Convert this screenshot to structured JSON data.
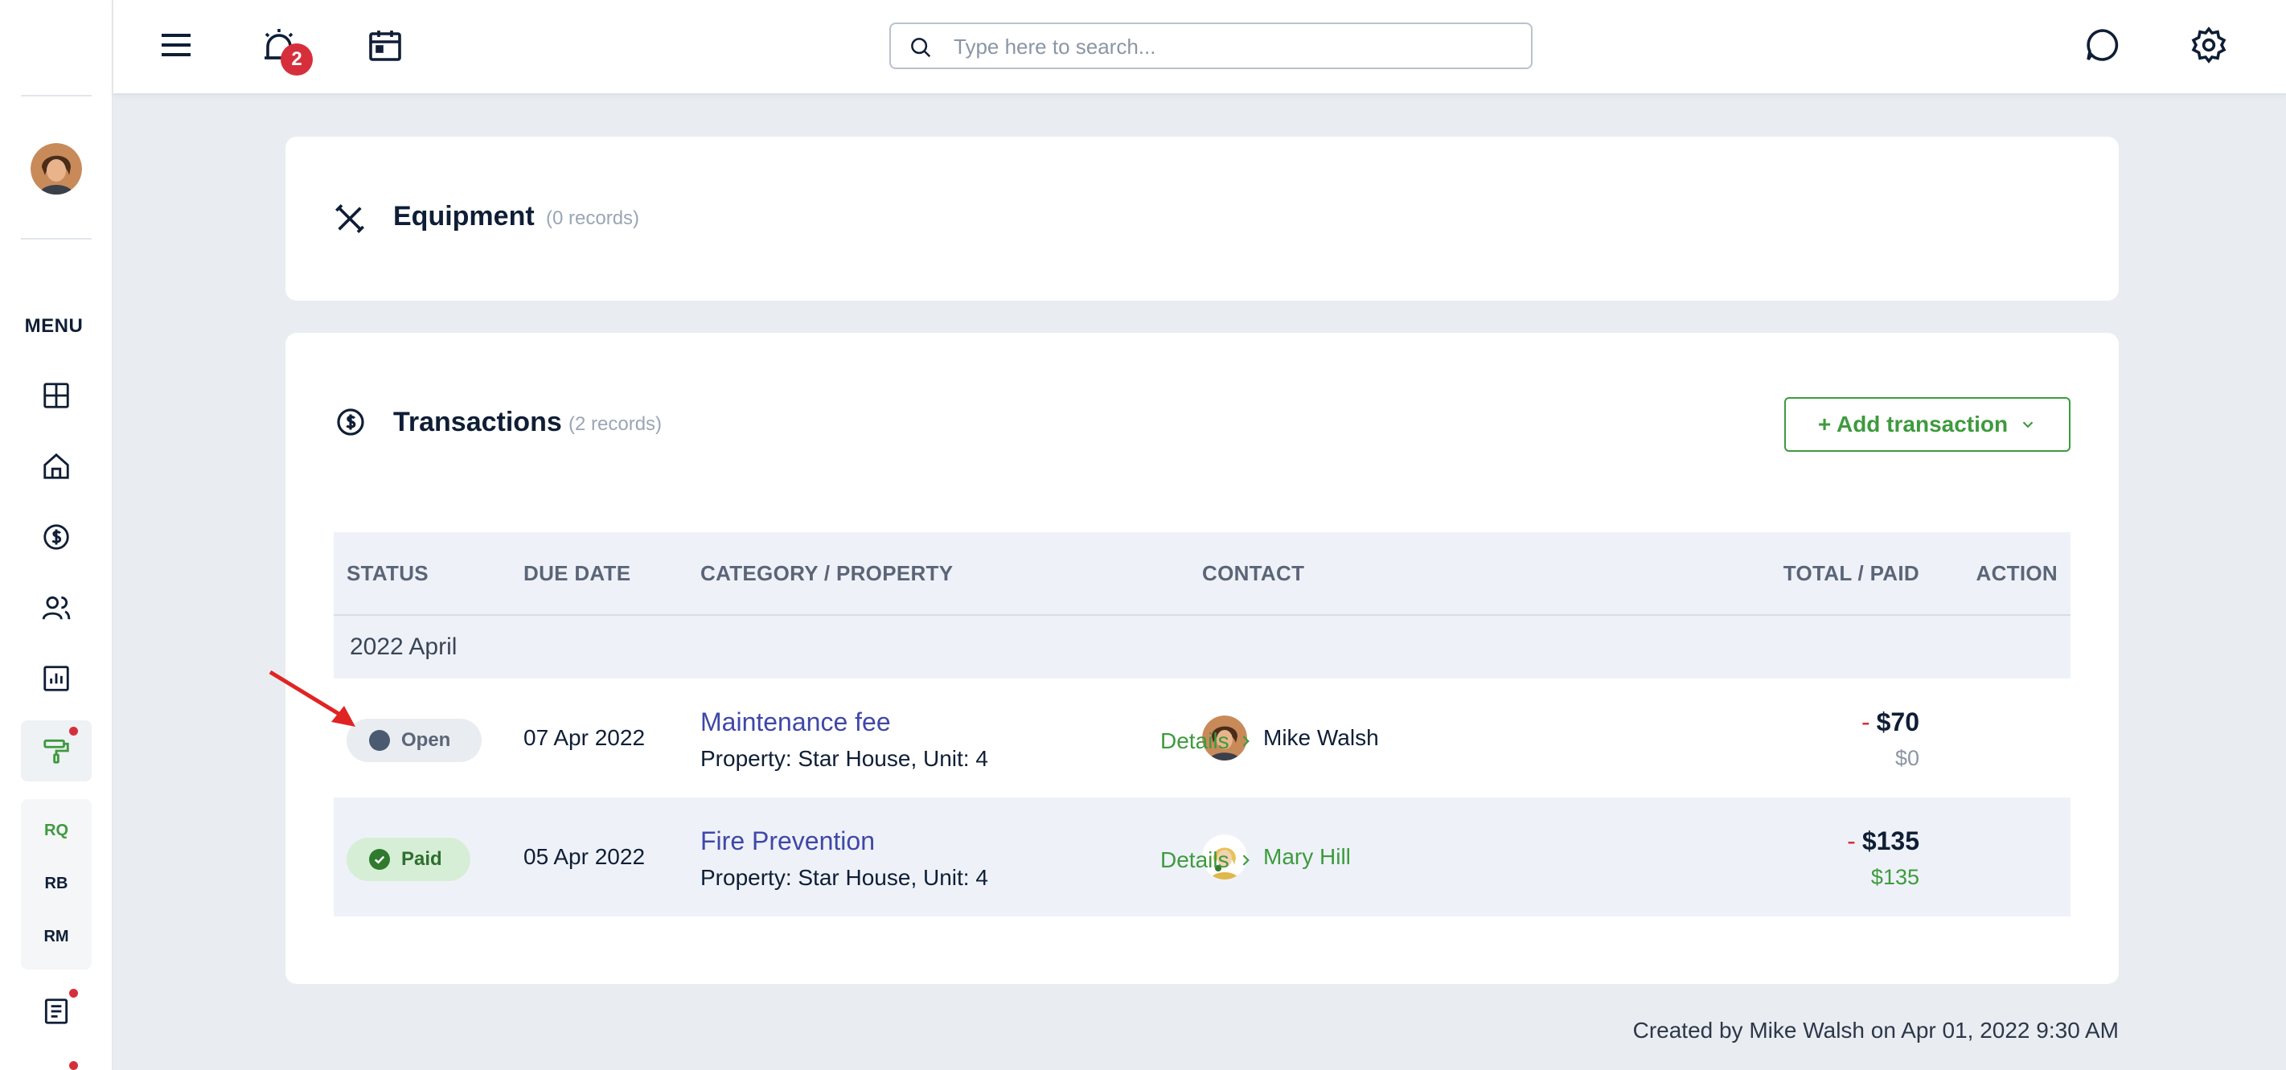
{
  "rail": {
    "menu_label": "MENU",
    "mini_items": [
      "RQ",
      "RB",
      "RM"
    ],
    "icons": [
      "dashboard-icon",
      "home-icon",
      "dollar-icon",
      "people-icon",
      "report-icon",
      "paint-roller-icon",
      "document-icon"
    ]
  },
  "topbar": {
    "notification_count": "2",
    "search_placeholder": "Type here to search..."
  },
  "equipment": {
    "title": "Equipment",
    "count": "(0 records)"
  },
  "transactions": {
    "title": "Transactions",
    "count": "(2 records)",
    "add_button": "+ Add transaction",
    "columns": {
      "status": "STATUS",
      "due_date": "DUE DATE",
      "category": "CATEGORY / PROPERTY",
      "contact": "CONTACT",
      "total": "TOTAL / PAID",
      "action": "ACTION"
    },
    "group": "2022 April",
    "rows": [
      {
        "status": "Open",
        "due_date": "07 Apr 2022",
        "category": "Maintenance fee",
        "property": "Property: Star House, Unit: 4",
        "contact": "Mike Walsh",
        "minus": "-",
        "total": "$70",
        "paid": "$0",
        "action": "Details"
      },
      {
        "status": "Paid",
        "due_date": "05 Apr 2022",
        "category": "Fire Prevention",
        "property": "Property: Star House, Unit: 4",
        "contact": "Mary Hill",
        "minus": "-",
        "total": "$135",
        "paid": "$135",
        "action": "Details"
      }
    ]
  },
  "footer": {
    "created_by": "Created by Mike Walsh on Apr 01, 2022 9:30 AM"
  },
  "colors": {
    "accent_green": "#3e9a3e",
    "link_blue": "#3f47a8",
    "alert_red": "#d62f3b",
    "background": "#e9edf2"
  }
}
